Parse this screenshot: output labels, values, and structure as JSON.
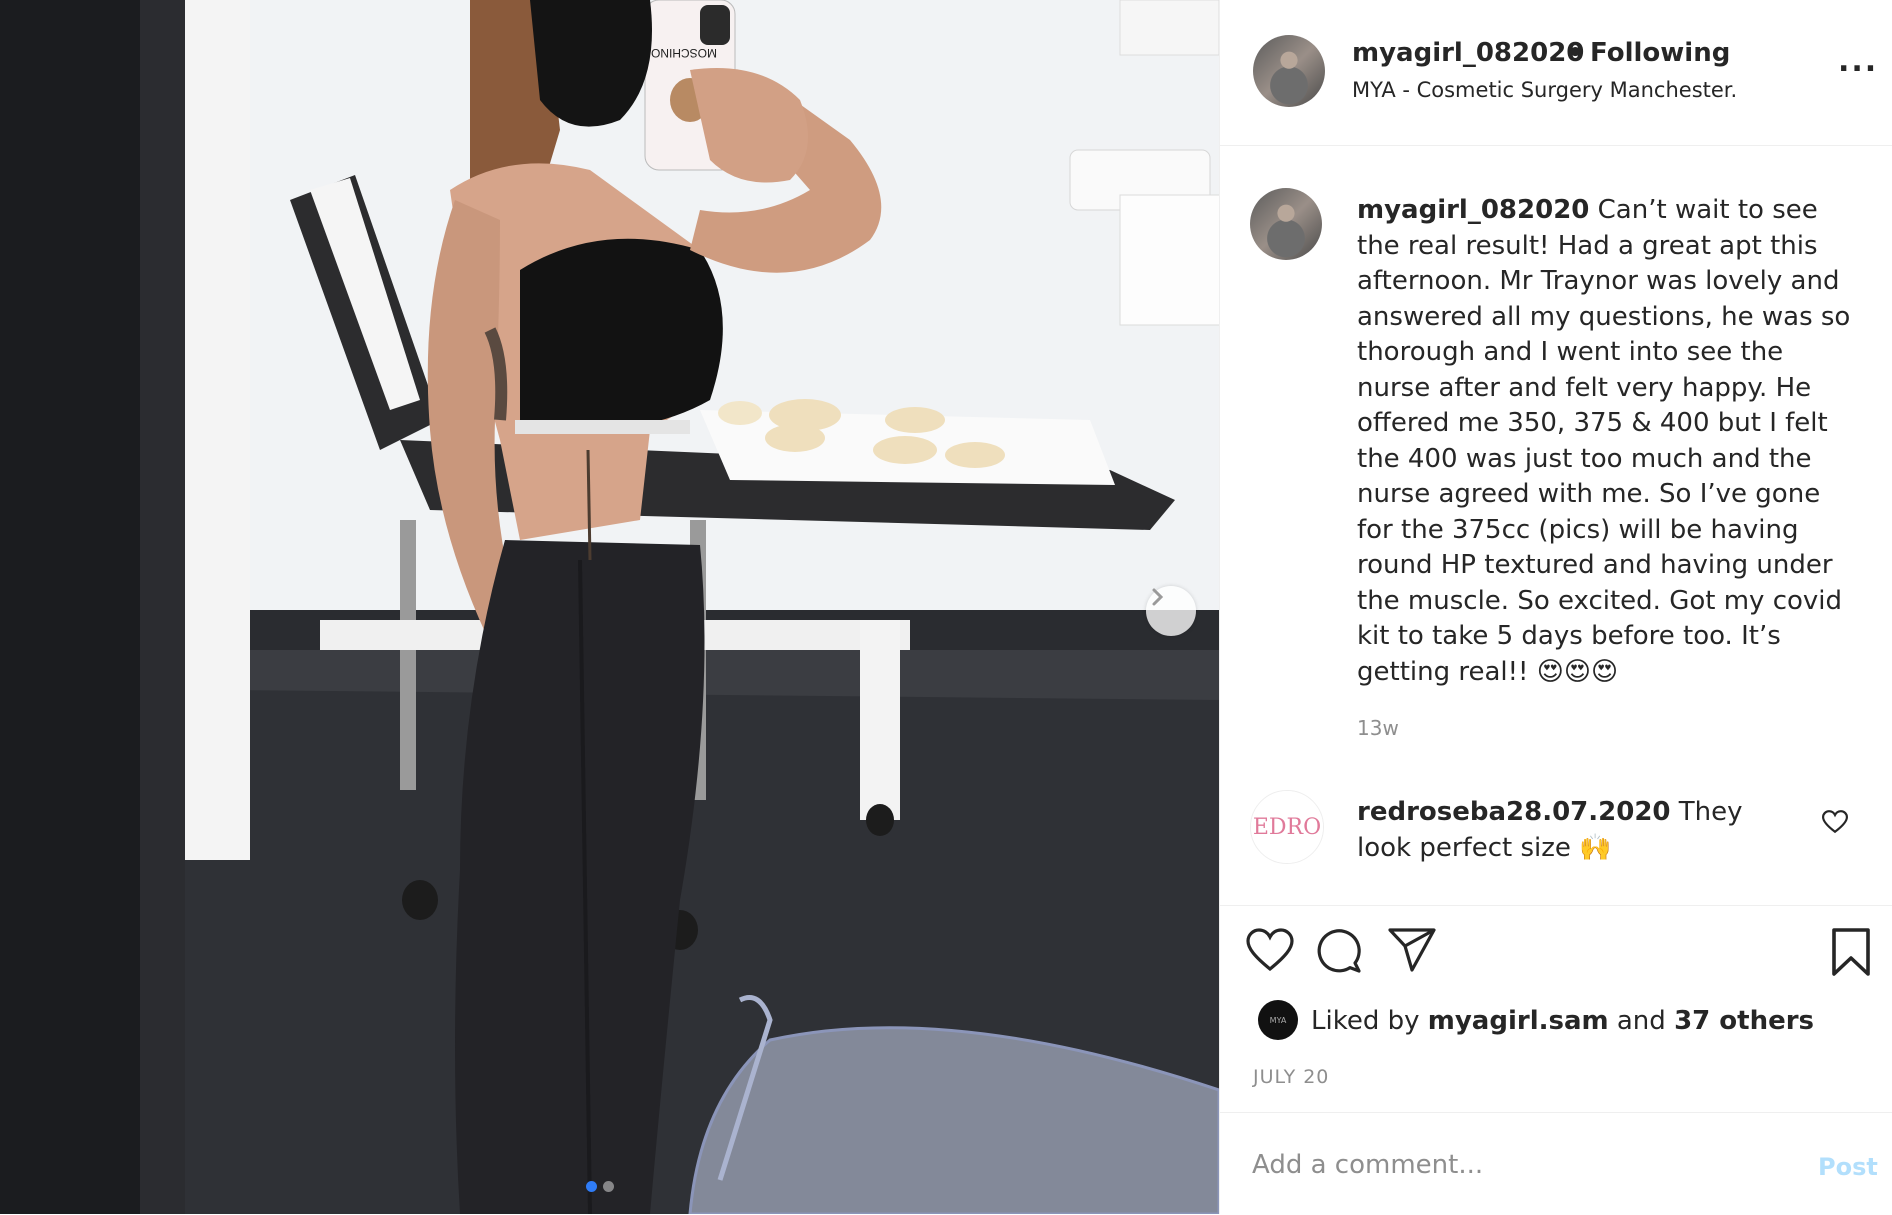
{
  "header": {
    "username": "myagirl_082020",
    "separator": "•",
    "follow_status": "Following",
    "location": "MYA - Cosmetic Surgery Manchester.",
    "more_label": "..."
  },
  "photo": {
    "phone_case_text": "MOSCHINO",
    "carousel_count": 2,
    "carousel_active": 1
  },
  "caption": {
    "username": "myagirl_082020",
    "text": "Can’t wait to see the real result! Had a great apt this afternoon. Mr Traynor was lovely and answered all my questions, he was so thorough and I went into see the nurse after and felt very happy. He offered me 350, 375 & 400 but I felt the 400 was just too much and the nurse agreed with me. So I’ve gone for the 375cc (pics) will be having round HP textured and having under the muscle. So excited. Got my covid kit to take 5 days before too. It’s getting real!! 😍😍😍",
    "age": "13w"
  },
  "comment": {
    "avatar_text": "EDRO",
    "username": "redroseba28.07.2020",
    "text": "They look perfect size 🙌"
  },
  "likes": {
    "prefix": "Liked by",
    "user": "myagirl.sam",
    "middle": "and",
    "others": "37 others",
    "avatar_text": "MYA"
  },
  "post_date": "JULY 20",
  "comment_box": {
    "placeholder": "Add a comment...",
    "post_label": "Post"
  },
  "colors": {
    "link_blue": "#b2dffc",
    "muted": "#8e8e8e",
    "carousel_active": "#2f7cf6"
  }
}
